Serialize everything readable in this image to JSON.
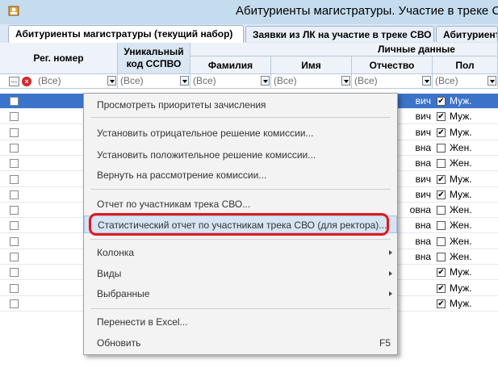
{
  "window": {
    "title": "Абитуриенты магистратуры. Участие в треке С"
  },
  "tabs": [
    {
      "label": "Абитуриенты магистратуры (текущий набор)",
      "active": true
    },
    {
      "label": "Заявки из ЛК на участие в треке СВО",
      "active": false
    },
    {
      "label": "Абитуриент",
      "active": false
    }
  ],
  "grid": {
    "headers": {
      "reg_number": "Рег. номер",
      "sspvo_code": "Уникальный код ССПВО",
      "personal_group": "Личные данные",
      "last_name": "Фамилия",
      "first_name": "Имя",
      "patronymic": "Отчество",
      "gender": "Пол"
    },
    "filter_all": "(Все)",
    "rows": [
      {
        "selected": true,
        "patronymic": "вич",
        "gender_checked": true,
        "gender": "Муж."
      },
      {
        "selected": false,
        "patronymic": "вич",
        "gender_checked": true,
        "gender": "Муж."
      },
      {
        "selected": false,
        "patronymic": "вич",
        "gender_checked": true,
        "gender": "Муж."
      },
      {
        "selected": false,
        "patronymic": "вна",
        "gender_checked": false,
        "gender": "Жен."
      },
      {
        "selected": false,
        "patronymic": "вна",
        "gender_checked": false,
        "gender": "Жен."
      },
      {
        "selected": false,
        "patronymic": "вич",
        "gender_checked": true,
        "gender": "Муж."
      },
      {
        "selected": false,
        "patronymic": "вич",
        "gender_checked": true,
        "gender": "Муж."
      },
      {
        "selected": false,
        "patronymic": "овна",
        "gender_checked": false,
        "gender": "Жен."
      },
      {
        "selected": false,
        "patronymic": "вна",
        "gender_checked": false,
        "gender": "Жен."
      },
      {
        "selected": false,
        "patronymic": "вна",
        "gender_checked": false,
        "gender": "Жен."
      },
      {
        "selected": false,
        "patronymic": "вна",
        "gender_checked": false,
        "gender": "Жен."
      },
      {
        "selected": false,
        "patronymic": "",
        "gender_checked": true,
        "gender": "Муж."
      },
      {
        "selected": false,
        "patronymic": "",
        "gender_checked": true,
        "gender": "Муж."
      },
      {
        "selected": false,
        "patronymic": "",
        "gender_checked": true,
        "gender": "Муж."
      }
    ]
  },
  "context_menu": {
    "items": [
      {
        "label": "Просмотреть приоритеты зачисления"
      },
      {
        "label": "Установить отрицательное решение комиссии..."
      },
      {
        "label": "Установить положительное решение комиссии..."
      },
      {
        "label": "Вернуть на рассмотрение комиссии..."
      },
      {
        "label": "Отчет по участникам трека СВО..."
      },
      {
        "label": "Статистический отчет по участникам трека СВО (для ректора)..."
      },
      {
        "label": "Колонка"
      },
      {
        "label": "Виды"
      },
      {
        "label": "Выбранные"
      },
      {
        "label": "Перенести в Excel..."
      },
      {
        "label": "Обновить",
        "shortcut": "F5"
      }
    ]
  },
  "colors": {
    "highlight_border": "#e3171c",
    "selection": "#3b73c9"
  }
}
